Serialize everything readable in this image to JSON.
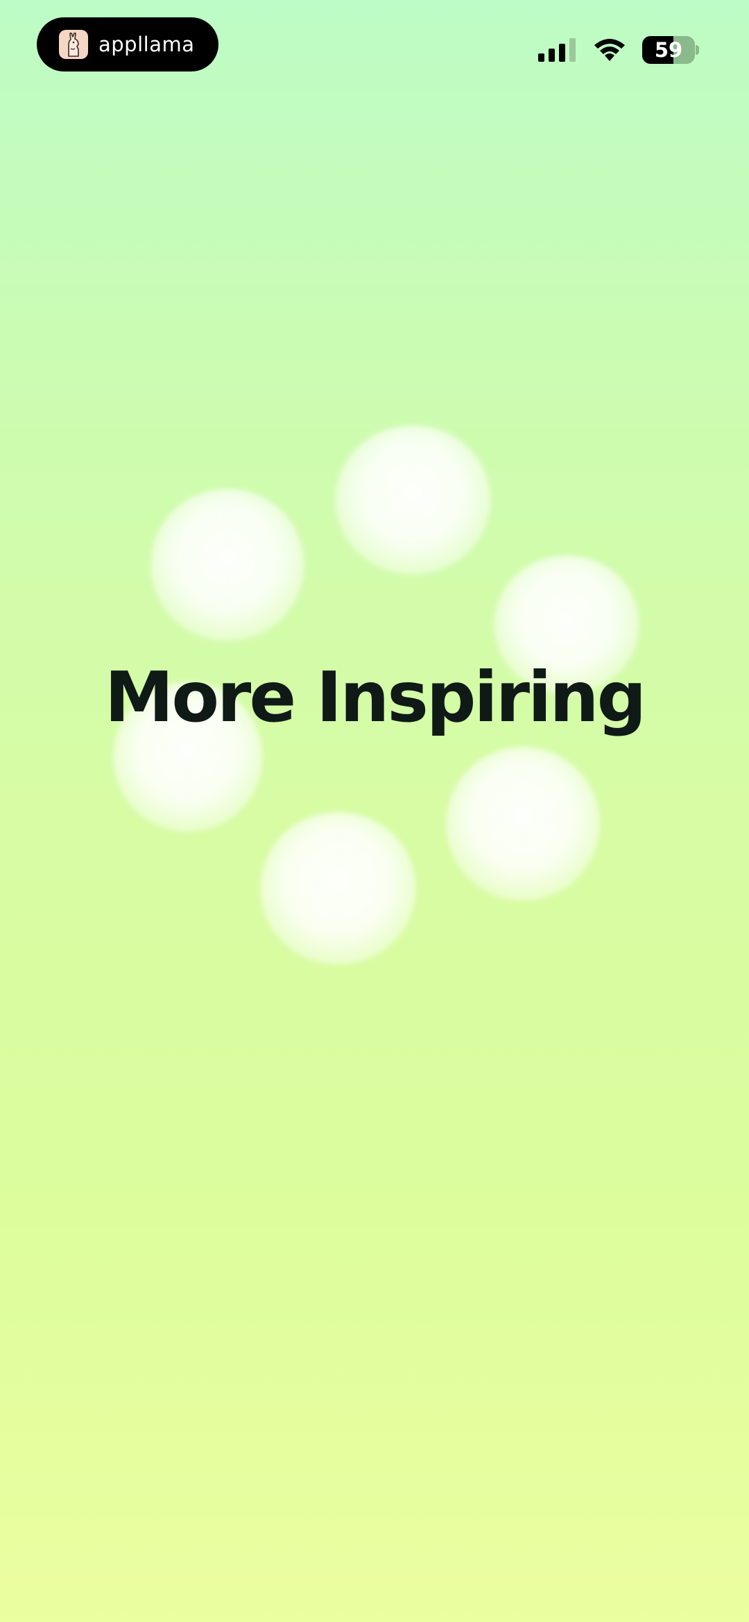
{
  "status_bar": {
    "app_name": "appllama",
    "app_icon": "llama-icon",
    "signal_icon": "cellular-signal-icon",
    "wifi_icon": "wifi-icon",
    "battery_level": "59",
    "battery_fraction": 0.59
  },
  "main": {
    "headline": "More Inspiring"
  },
  "colors": {
    "gradient_top": "#bdfcc6",
    "gradient_bottom": "#ebfea0",
    "headline": "#0f1a17",
    "pill": "#000000"
  }
}
